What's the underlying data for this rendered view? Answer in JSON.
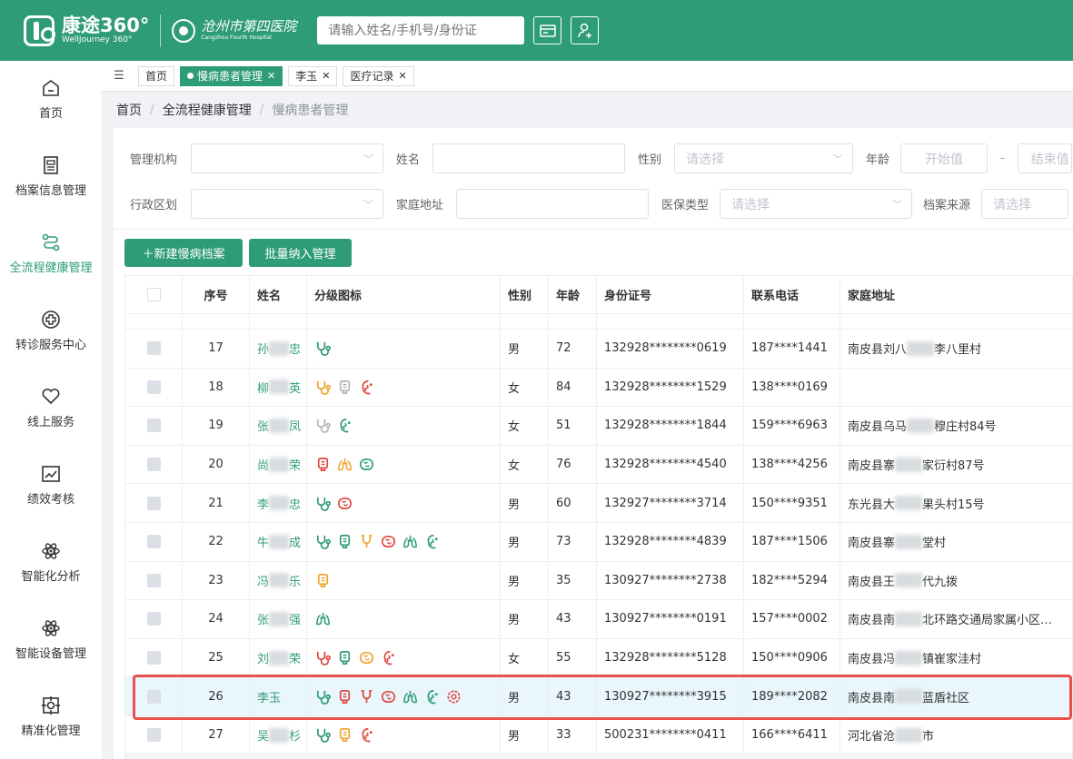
{
  "header": {
    "brand_name": "康途360°",
    "brand_sub": "WellJourney 360°",
    "hospital_name": "沧州市第四医院",
    "hospital_sub": "Cangzhou Fourth Hospital",
    "search_placeholder": "请输入姓名/手机号/身份证",
    "icons": [
      "card-icon",
      "add-user-icon"
    ]
  },
  "sidebar": {
    "items": [
      {
        "label": "首页",
        "icon": "home-icon",
        "active": false
      },
      {
        "label": "档案信息管理",
        "icon": "document-icon",
        "active": false
      },
      {
        "label": "全流程健康管理",
        "icon": "flow-icon",
        "active": true
      },
      {
        "label": "转诊服务中心",
        "icon": "medical-cross-icon",
        "active": false
      },
      {
        "label": "线上服务",
        "icon": "heart-hands-icon",
        "active": false
      },
      {
        "label": "绩效考核",
        "icon": "chart-icon",
        "active": false
      },
      {
        "label": "智能化分析",
        "icon": "atom-icon",
        "active": false
      },
      {
        "label": "智能设备管理",
        "icon": "atom-icon",
        "active": false
      },
      {
        "label": "精准化管理",
        "icon": "target-icon",
        "active": false
      }
    ]
  },
  "tabs": [
    {
      "label": "首页",
      "active": false,
      "closable": false
    },
    {
      "label": "慢病患者管理",
      "active": true,
      "closable": true
    },
    {
      "label": "李玉",
      "active": false,
      "closable": true
    },
    {
      "label": "医疗记录",
      "active": false,
      "closable": true
    }
  ],
  "breadcrumb": [
    "首页",
    "全流程健康管理",
    "慢病患者管理"
  ],
  "filters": {
    "org_label": "管理机构",
    "name_label": "姓名",
    "gender_label": "性别",
    "gender_placeholder": "请选择",
    "age_label": "年龄",
    "age_start": "开始值",
    "age_dash": "-",
    "age_end": "结束值",
    "region_label": "行政区划",
    "address_label": "家庭地址",
    "insurance_label": "医保类型",
    "insurance_placeholder": "请选择",
    "source_label": "档案来源",
    "source_placeholder": "请选择"
  },
  "buttons": {
    "new_label": "＋新建慢病档案",
    "batch_label": "批量纳入管理"
  },
  "table": {
    "headers": [
      "序号",
      "姓名",
      "分级图标",
      "性别",
      "年龄",
      "身份证号",
      "联系电话",
      "家庭地址"
    ],
    "rows": [
      {
        "no": "17",
        "name_a": "孙",
        "name_b": "忠",
        "icons": [
          "stethoscope-icon"
        ],
        "gender": "男",
        "age": "72",
        "id": "132928********0619",
        "phone": "187****1441",
        "addr_a": "南皮县刘八",
        "addr_b": "李八里村"
      },
      {
        "no": "18",
        "name_a": "柳",
        "name_b": "英",
        "icons": [
          "stethoscope-icon",
          "bottle-icon",
          "kidney-icon"
        ],
        "gender": "女",
        "age": "84",
        "id": "132928********1529",
        "phone": "138****0169",
        "addr_a": "",
        "addr_b": ""
      },
      {
        "no": "19",
        "name_a": "张",
        "name_b": "凤",
        "icons": [
          "stethoscope-icon",
          "kidney-icon"
        ],
        "gender": "女",
        "age": "51",
        "id": "132928********1844",
        "phone": "159****6963",
        "addr_a": "南皮县乌马",
        "addr_b": "穆庄村84号"
      },
      {
        "no": "20",
        "name_a": "尚",
        "name_b": "荣",
        "icons": [
          "bottle-icon",
          "lungs-icon",
          "brain-icon"
        ],
        "gender": "女",
        "age": "76",
        "id": "132928********4540",
        "phone": "138****4256",
        "addr_a": "南皮县寨",
        "addr_b": "家衍村87号"
      },
      {
        "no": "21",
        "name_a": "李",
        "name_b": "忠",
        "icons": [
          "stethoscope-icon",
          "brain-icon"
        ],
        "gender": "男",
        "age": "60",
        "id": "132927********3714",
        "phone": "150****9351",
        "addr_a": "东光县大",
        "addr_b": "果头村15号"
      },
      {
        "no": "22",
        "name_a": "牛",
        "name_b": "成",
        "icons": [
          "stethoscope-icon",
          "bottle-icon",
          "heart-icon",
          "brain-icon",
          "lungs-icon",
          "kidney-icon"
        ],
        "gender": "男",
        "age": "73",
        "id": "132928********4839",
        "phone": "187****1506",
        "addr_a": "南皮县寨",
        "addr_b": "堂村"
      },
      {
        "no": "23",
        "name_a": "冯",
        "name_b": "乐",
        "icons": [
          "bottle-icon"
        ],
        "gender": "男",
        "age": "35",
        "id": "130927********2738",
        "phone": "182****5294",
        "addr_a": "南皮县王",
        "addr_b": "代九拨"
      },
      {
        "no": "24",
        "name_a": "张",
        "name_b": "强",
        "icons": [
          "lungs-icon"
        ],
        "gender": "男",
        "age": "43",
        "id": "130927********0191",
        "phone": "157****0002",
        "addr_a": "南皮县南",
        "addr_b": "北环路交通局家属小区…"
      },
      {
        "no": "25",
        "name_a": "刘",
        "name_b": "荣",
        "icons": [
          "stethoscope-icon",
          "bottle-icon",
          "brain-icon",
          "kidney-icon"
        ],
        "gender": "女",
        "age": "55",
        "id": "132928********5128",
        "phone": "150****0906",
        "addr_a": "南皮县冯",
        "addr_b": "镇崔家洼村"
      },
      {
        "no": "26",
        "name_a": "李玉",
        "name_b": "",
        "icons": [
          "stethoscope-icon",
          "bottle-icon",
          "heart-icon",
          "brain-icon",
          "lungs-icon",
          "kidney-icon",
          "brain2-icon"
        ],
        "gender": "男",
        "age": "43",
        "id": "130927********3915",
        "phone": "189****2082",
        "addr_a": "南皮县南",
        "addr_b": "蓝盾社区",
        "highlight": true
      },
      {
        "no": "27",
        "name_a": "吴",
        "name_b": "杉",
        "icons": [
          "stethoscope-icon",
          "bottle-icon",
          "kidney-icon"
        ],
        "gender": "男",
        "age": "33",
        "id": "500231********0411",
        "phone": "166****6411",
        "addr_a": "河北省沧",
        "addr_b": "市"
      }
    ]
  },
  "colors": {
    "primary": "#2e9c75",
    "highlight_border": "#e8514c",
    "icon_green": "#2e9c75",
    "icon_orange": "#f0a22d",
    "icon_red": "#e0473f",
    "icon_gray": "#b5b5b5"
  }
}
